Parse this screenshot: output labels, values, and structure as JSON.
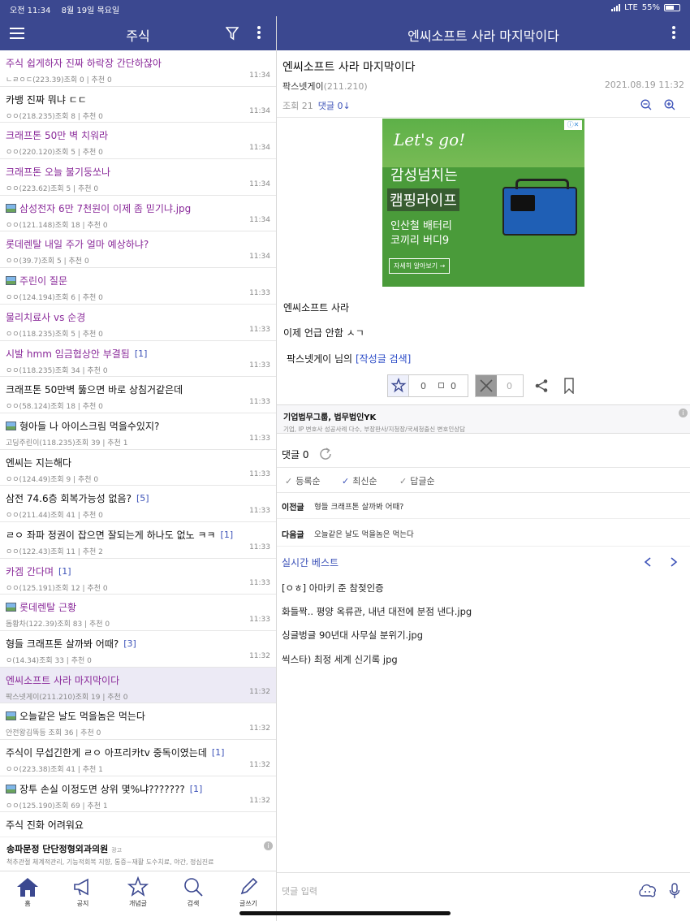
{
  "status": {
    "time": "오전 11:34",
    "date": "8월 19일 목요일",
    "network": "LTE",
    "battery": "55%"
  },
  "left_header": {
    "title": "주식"
  },
  "posts": [
    {
      "title": "주식 쉽게하자 진짜 하락장 간단하잖아",
      "meta": "ㄴㄹㅇㄷ(223.39)조회 0 | 추천 0",
      "time": "11:34",
      "visited": true
    },
    {
      "title": "카뱅 진짜 뭐냐 ㄷㄷ",
      "meta": "ㅇㅇ(218.235)조회 8 | 추천 0",
      "time": "11:34"
    },
    {
      "title": "크래프톤 50만 벽 치워라",
      "meta": "ㅇㅇ(220.120)조회 5 | 추천 0",
      "time": "11:34",
      "visited": true
    },
    {
      "title": "크래프톤 오늘 불기둥쏘나",
      "meta": "ㅇㅇ(223.62)조회 5 | 추천 0",
      "time": "11:34",
      "visited": true
    },
    {
      "title": "삼성전자 6만 7천원이 이제 좀 믿기냐.jpg",
      "meta": "ㅇㅇ(121.148)조회 18 | 추천 0",
      "time": "11:34",
      "visited": true,
      "img": true
    },
    {
      "title": "롯데렌탈 내일 주가 얼마 예상하냐?",
      "meta": "ㅇㅇ(39.7)조회 5 | 추천 0",
      "time": "11:34",
      "visited": true
    },
    {
      "title": "주린이 질문",
      "meta": "ㅇㅇ(124.194)조회 6 | 추천 0",
      "time": "11:33",
      "visited": true,
      "img": true
    },
    {
      "title": "물리치료사 vs 순경",
      "meta": "ㅇㅇ(118.235)조회 5 | 추천 0",
      "time": "11:33",
      "visited": true
    },
    {
      "title": "시발 hmm 임금협상안 부결됨",
      "count": "[1]",
      "meta": "ㅇㅇ(118.235)조회 34 | 추천 0",
      "time": "11:33",
      "visited": true
    },
    {
      "title": "크래프톤 50만벽 뚫으면 바로 상침거같은데",
      "meta": "ㅇㅇ(58.124)조회 18 | 추천 0",
      "time": "11:33"
    },
    {
      "title": "형아들 나 아이스크림 먹을수있지?",
      "meta": "고딩주린이(118.235)조회 39 | 추천 1",
      "time": "11:33",
      "img": true
    },
    {
      "title": "엔씨는 지는해다",
      "meta": "ㅇㅇ(124.49)조회 9 | 추천 0",
      "time": "11:33"
    },
    {
      "title": "삼전 74.6층 회복가능성 없음?",
      "count": "[5]",
      "meta": "ㅇㅇ(211.44)조회 41 | 추천 0",
      "time": "11:33"
    },
    {
      "title": "ㄹㅇ 좌파 정권이 잡으면 잘되는게 하나도 없노 ㅋㅋ",
      "count": "[1]",
      "meta": "ㅇㅇ(122.43)조회 11 | 추천 2",
      "time": "11:33"
    },
    {
      "title": "카겜 간다며",
      "count": "[1]",
      "meta": "ㅇㅇ(125.191)조회 12 | 추천 0",
      "time": "11:33",
      "visited": true
    },
    {
      "title": "롯데렌탈 근황",
      "meta": "돔황차(122.39)조회 83 | 추천 0",
      "time": "11:33",
      "visited": true,
      "img": true
    },
    {
      "title": "형들 크래프톤 살까봐 어때?",
      "count": "[3]",
      "meta": "ㅇ(14.34)조회 33 | 추천 0",
      "time": "11:32"
    },
    {
      "title": "엔씨소프트 사라 마지막이다",
      "meta": "팍스넷게이(211.210)조회 19 | 추천 0",
      "time": "11:32",
      "visited": true,
      "active": true
    },
    {
      "title": "오늘같은 날도 먹을놈은 먹는다",
      "meta": "안전왕김똑등 조회 36 | 추천 0",
      "time": "11:32",
      "img": true
    },
    {
      "title": "주식이 무섭긴한게 ㄹㅇ 아프리카tv 중독이였는데",
      "count": "[1]",
      "meta": "ㅇㅇ(223.38)조회 41 | 추천 1",
      "time": "11:32"
    },
    {
      "title": "장투 손실 이정도면 상위 몇%냐???????",
      "count": "[1]",
      "meta": "ㅇㅇ(125.190)조회 69 | 추천 1",
      "time": "11:32",
      "img": true
    },
    {
      "title": "주식 진화 어려워요",
      "meta": "",
      "time": ""
    }
  ],
  "left_ad": {
    "title": "송파문정 단단정형외과의원",
    "tag": "광고",
    "desc": "척추관절 체계적관리, 기능적회복 지향, 통증~재활 도수치료, 야간, 정심진료"
  },
  "tabs": [
    {
      "label": "홈"
    },
    {
      "label": "공지"
    },
    {
      "label": "개념글"
    },
    {
      "label": "검색"
    },
    {
      "label": "글쓰기"
    }
  ],
  "right_header": {
    "title": "엔씨소프트 사라 마지막이다"
  },
  "post": {
    "title": "엔씨소프트 사라 마지막이다",
    "author": "팍스넷게이",
    "ip": "(211.210)",
    "date": "2021.08.19 11:32",
    "views": "조회 21",
    "comments_link": "댓글 0↓",
    "body": [
      "엔씨소프트 사라",
      "이제 언급 안함 ㅅㄱ"
    ],
    "author_search_prefix": "팍스넷게이 님의",
    "author_search_link": "[작성글 검색]",
    "upvotes": "0",
    "upvotes_fixed": "0",
    "downvotes": "0"
  },
  "ad_banner": {
    "headline": "Let's go!",
    "line1": "감성넘치는",
    "line2": "캠핑라이프",
    "line3": "인산철 배터리",
    "line4": "코끼리 버디9",
    "cta": "자세히 알아보기 →"
  },
  "law_ad": {
    "title": "기업법무그룹, 법무법인YK",
    "desc": "기업, IP 변호사 성공사례 다수, 부장판사/지청장/국세청출신 변호인상담"
  },
  "comments": {
    "header": "댓글 0",
    "sort_options": [
      "등록순",
      "최신순",
      "답글순"
    ]
  },
  "nav": {
    "prev_label": "이전글",
    "prev_title": "형들 크래프톤 살까봐 어때?",
    "next_label": "다음글",
    "next_title": "오늘같은 날도 먹을놈은 먹는다"
  },
  "best": {
    "title": "실시간 베스트",
    "items": [
      "[ㅇㅎ] 아마키 준 참젖인증",
      "화들짝.. 평양 옥류관, 내년 대전에 분점 낸다.jpg",
      "싱글벙글 90년대 사무실 분위기.jpg",
      "씩스타) 최정 세계 신기록 jpg"
    ]
  },
  "reply": {
    "placeholder": "댓글 입력"
  },
  "colors": {
    "brand": "#3b4890",
    "visited": "#8a2a9a",
    "link": "#3c52b8"
  }
}
